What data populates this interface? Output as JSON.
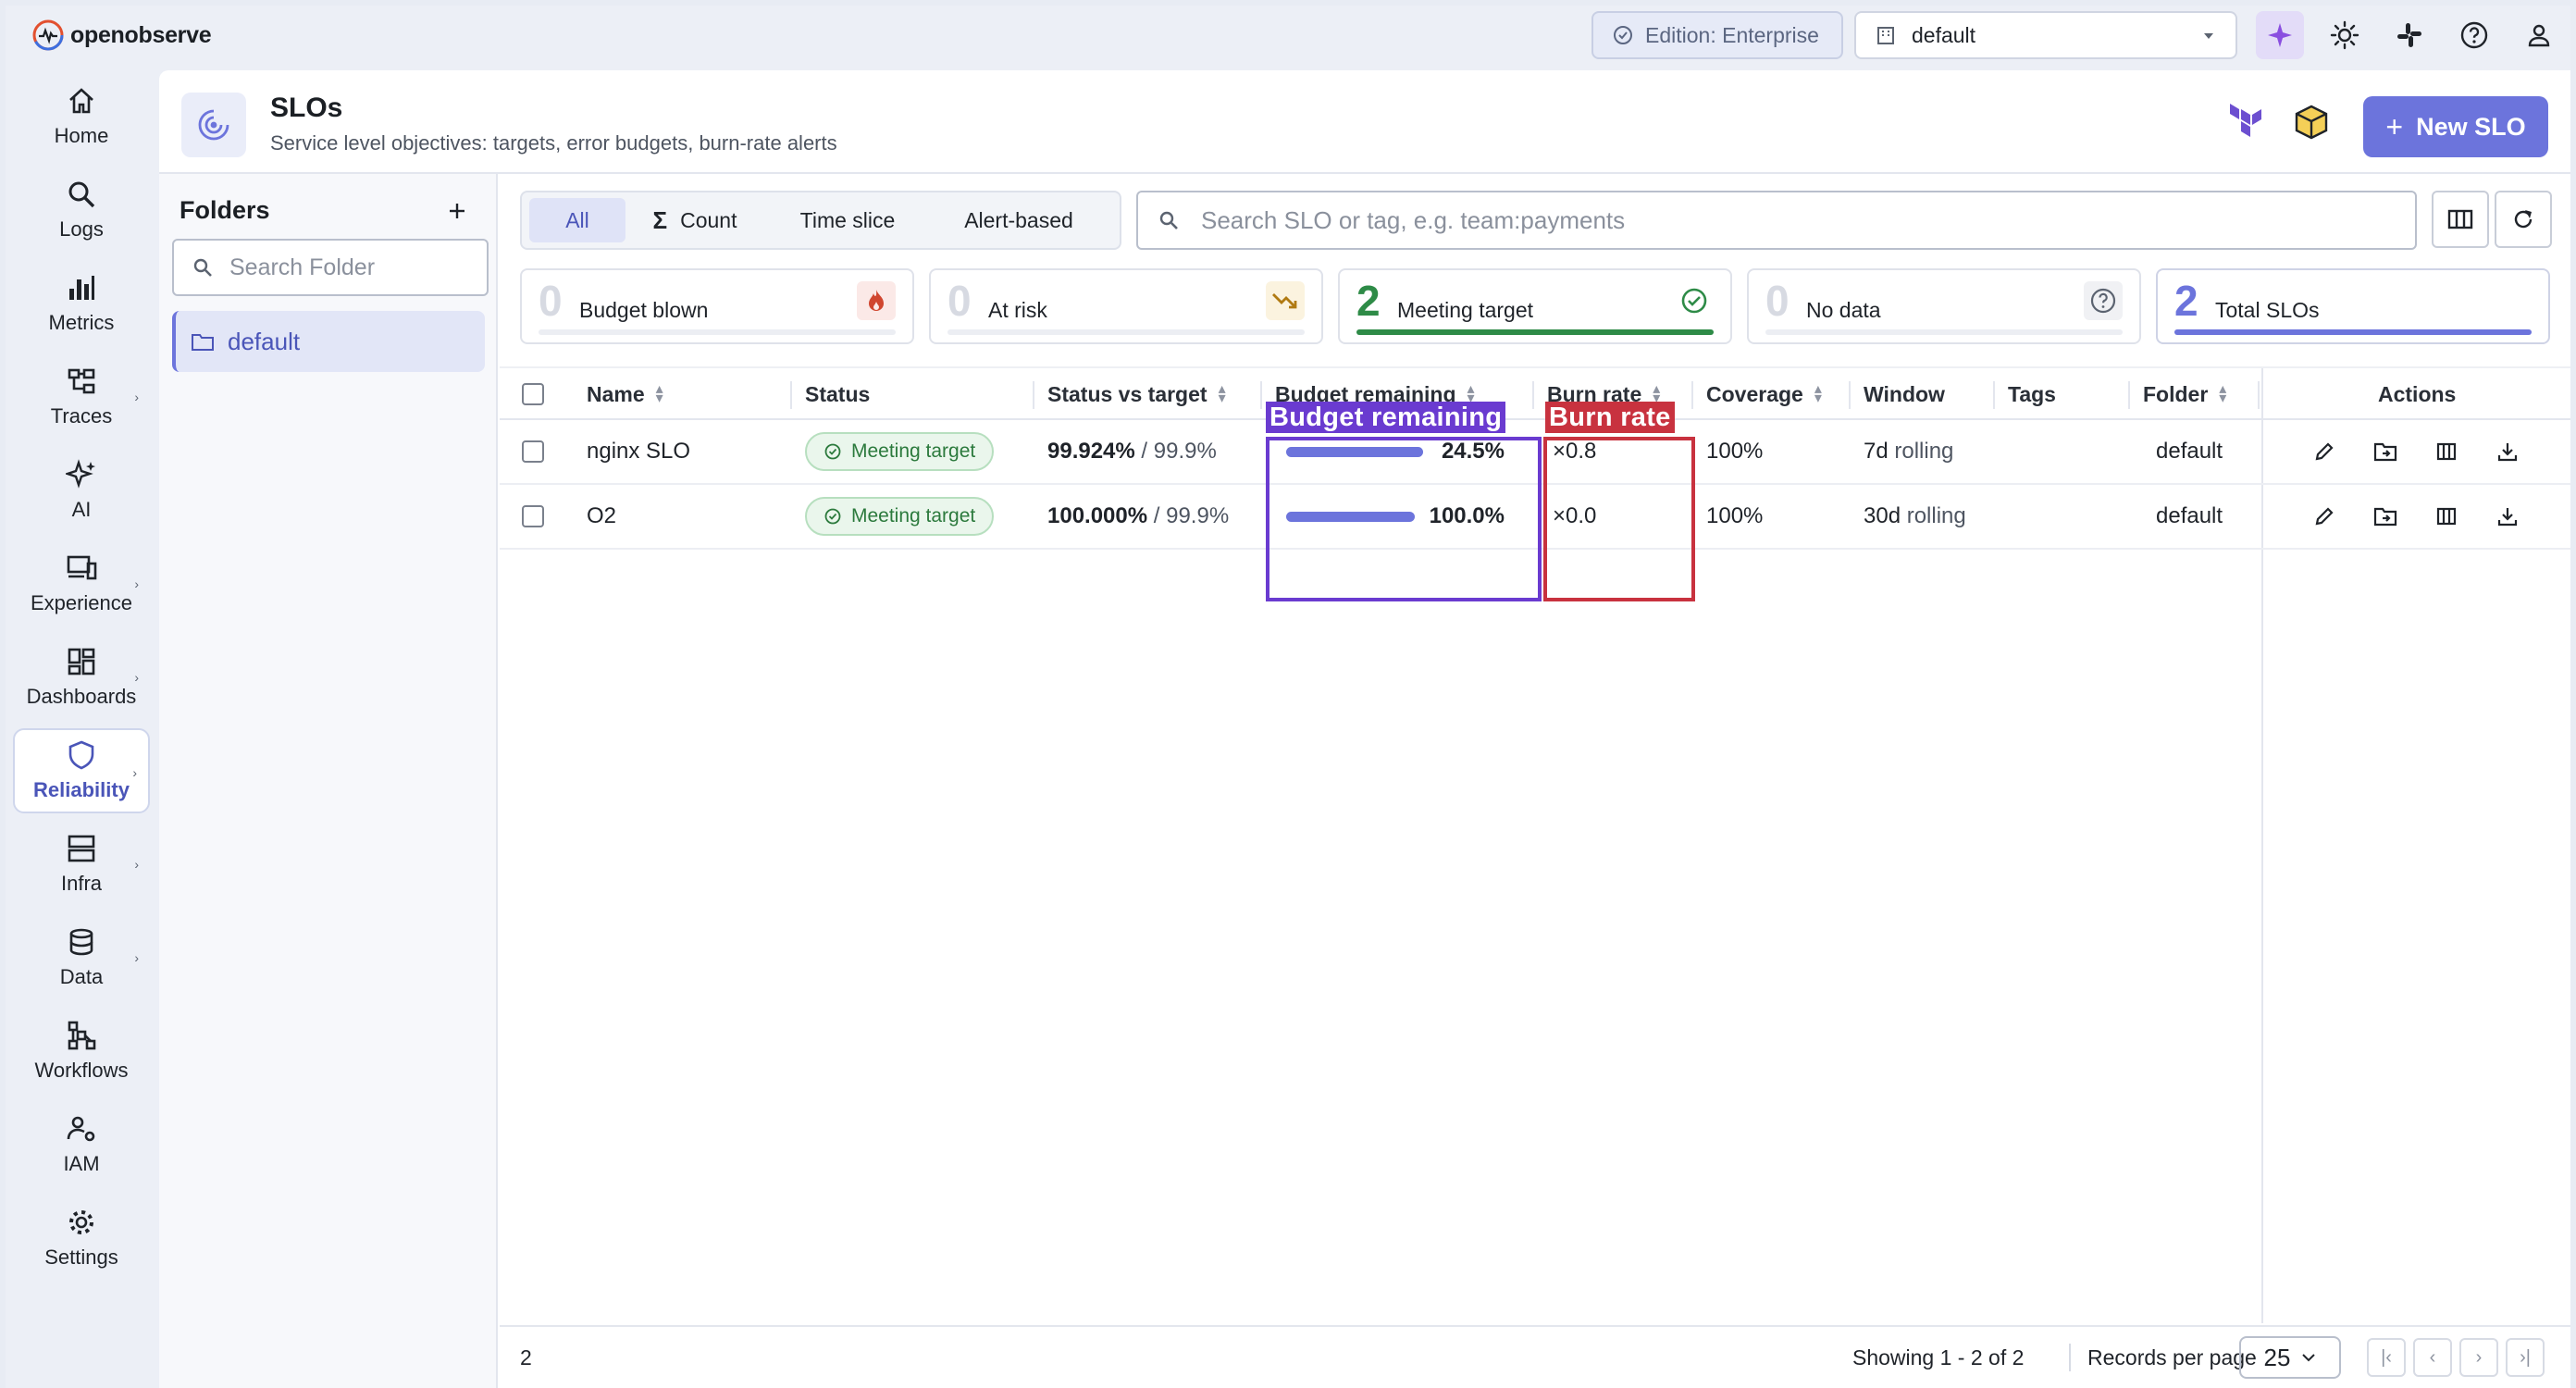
{
  "app": {
    "brand": "openobserve"
  },
  "topbar": {
    "edition": "Edition: Enterprise",
    "org": "default"
  },
  "nav": [
    {
      "label": "Home",
      "icon": "home-icon"
    },
    {
      "label": "Logs",
      "icon": "search-icon"
    },
    {
      "label": "Metrics",
      "icon": "bar-chart-icon"
    },
    {
      "label": "Traces",
      "icon": "traces-icon"
    },
    {
      "label": "AI",
      "icon": "sparkle-icon"
    },
    {
      "label": "Experience",
      "icon": "devices-icon"
    },
    {
      "label": "Dashboards",
      "icon": "dashboard-icon"
    },
    {
      "label": "Reliability",
      "icon": "shield-icon"
    },
    {
      "label": "Infra",
      "icon": "server-icon"
    },
    {
      "label": "Data",
      "icon": "database-icon"
    },
    {
      "label": "Workflows",
      "icon": "workflow-icon"
    },
    {
      "label": "IAM",
      "icon": "users-icon"
    },
    {
      "label": "Settings",
      "icon": "gear-icon"
    }
  ],
  "page": {
    "title": "SLOs",
    "subtitle": "Service level objectives: targets, error budgets, burn-rate alerts",
    "new_button": "New SLO"
  },
  "folders": {
    "title": "Folders",
    "search_placeholder": "Search Folder",
    "items": [
      "default"
    ]
  },
  "filters": {
    "tabs": [
      "All",
      "Count",
      "Time slice",
      "Alert-based"
    ],
    "active": "All",
    "search_placeholder": "Search SLO or tag, e.g. team:payments"
  },
  "stats": [
    {
      "value": "0",
      "label": "Budget blown",
      "icon": "flame-icon",
      "color": "#c0392b",
      "bar": 0
    },
    {
      "value": "0",
      "label": "At risk",
      "icon": "trending-down-icon",
      "color": "#b07a12",
      "bar": 0
    },
    {
      "value": "2",
      "label": "Meeting target",
      "icon": "check-circle-icon",
      "color": "#2e8b47",
      "bar": 1
    },
    {
      "value": "0",
      "label": "No data",
      "icon": "help-icon",
      "color": "#5b6370",
      "bar": 0
    },
    {
      "value": "2",
      "label": "Total SLOs",
      "icon": "",
      "color": "#6c74dc",
      "bar": 1
    }
  ],
  "table": {
    "columns": [
      "Name",
      "Status",
      "Status vs target",
      "Budget remaining",
      "Burn rate",
      "Coverage",
      "Window",
      "Tags",
      "Folder",
      "Actions"
    ],
    "rows": [
      {
        "name": "nginx SLO",
        "status": "Meeting target",
        "status_value": "99.924%",
        "target": "/ 99.9%",
        "budget": "24.5%",
        "budget_fraction": 0.245,
        "burn_rate": "×0.8",
        "coverage": "100%",
        "window_value": "7d",
        "window_label": "rolling",
        "tags": "",
        "folder": "default"
      },
      {
        "name": "O2",
        "status": "Meeting target",
        "status_value": "100.000%",
        "target": "/ 99.9%",
        "budget": "100.0%",
        "budget_fraction": 1.0,
        "burn_rate": "×0.0",
        "coverage": "100%",
        "window_value": "30d",
        "window_label": "rolling",
        "tags": "",
        "folder": "default"
      }
    ]
  },
  "overlays": {
    "budget_label": "Budget remaining",
    "burn_label": "Burn rate",
    "budget_color": "#6a3bd0",
    "burn_color": "#c8323f"
  },
  "footer": {
    "count": "2",
    "showing": "Showing 1 - 2 of 2",
    "records_per_page_label": "Records per page",
    "records_per_page": "25"
  },
  "colors": {
    "accent": "#6c74dc",
    "success": "#2e8b47"
  }
}
